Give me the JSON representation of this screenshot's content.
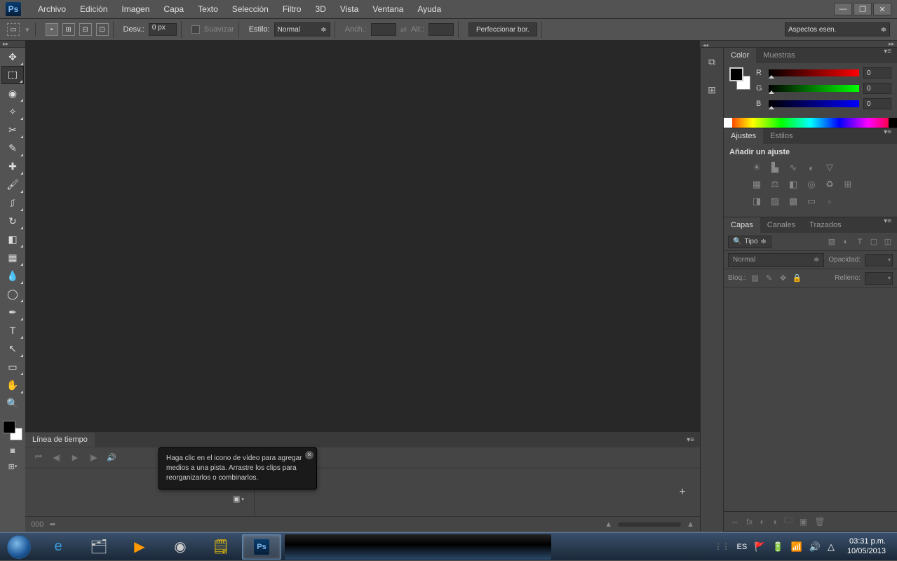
{
  "app": {
    "logo": "Ps"
  },
  "menu": [
    "Archivo",
    "Edición",
    "Imagen",
    "Capa",
    "Texto",
    "Selección",
    "Filtro",
    "3D",
    "Vista",
    "Ventana",
    "Ayuda"
  ],
  "options": {
    "desv_label": "Desv.:",
    "desv_value": "0 px",
    "suavizar": "Suavizar",
    "estilo_label": "Estilo:",
    "estilo_value": "Normal",
    "anch_label": "Anch.:",
    "alt_label": "Alt.:",
    "refine": "Perfeccionar bor.",
    "workspace": "Aspectos esen."
  },
  "panels": {
    "color": {
      "tab_color": "Color",
      "tab_muestras": "Muestras",
      "r_label": "R",
      "g_label": "G",
      "b_label": "B",
      "r_val": "0",
      "g_val": "0",
      "b_val": "0"
    },
    "adjustments": {
      "tab_ajustes": "Ajustes",
      "tab_estilos": "Estilos",
      "title": "Añadir un ajuste"
    },
    "layers": {
      "tab_capas": "Capas",
      "tab_canales": "Canales",
      "tab_trazados": "Trazados",
      "filter_tipo": "Tipo",
      "blend_mode": "Normal",
      "opacidad": "Opacidad:",
      "bloq": "Bloq.:",
      "relleno": "Relleno:"
    }
  },
  "timeline": {
    "tab": "Línea de tiempo",
    "tooltip": "Haga clic en el icono de vídeo para agregar medios a una pista. Arrastre los clips para reorganizarlos o combinarlos."
  },
  "taskbar": {
    "lang": "ES",
    "time": "03:31 p.m.",
    "date": "10/05/2013"
  }
}
